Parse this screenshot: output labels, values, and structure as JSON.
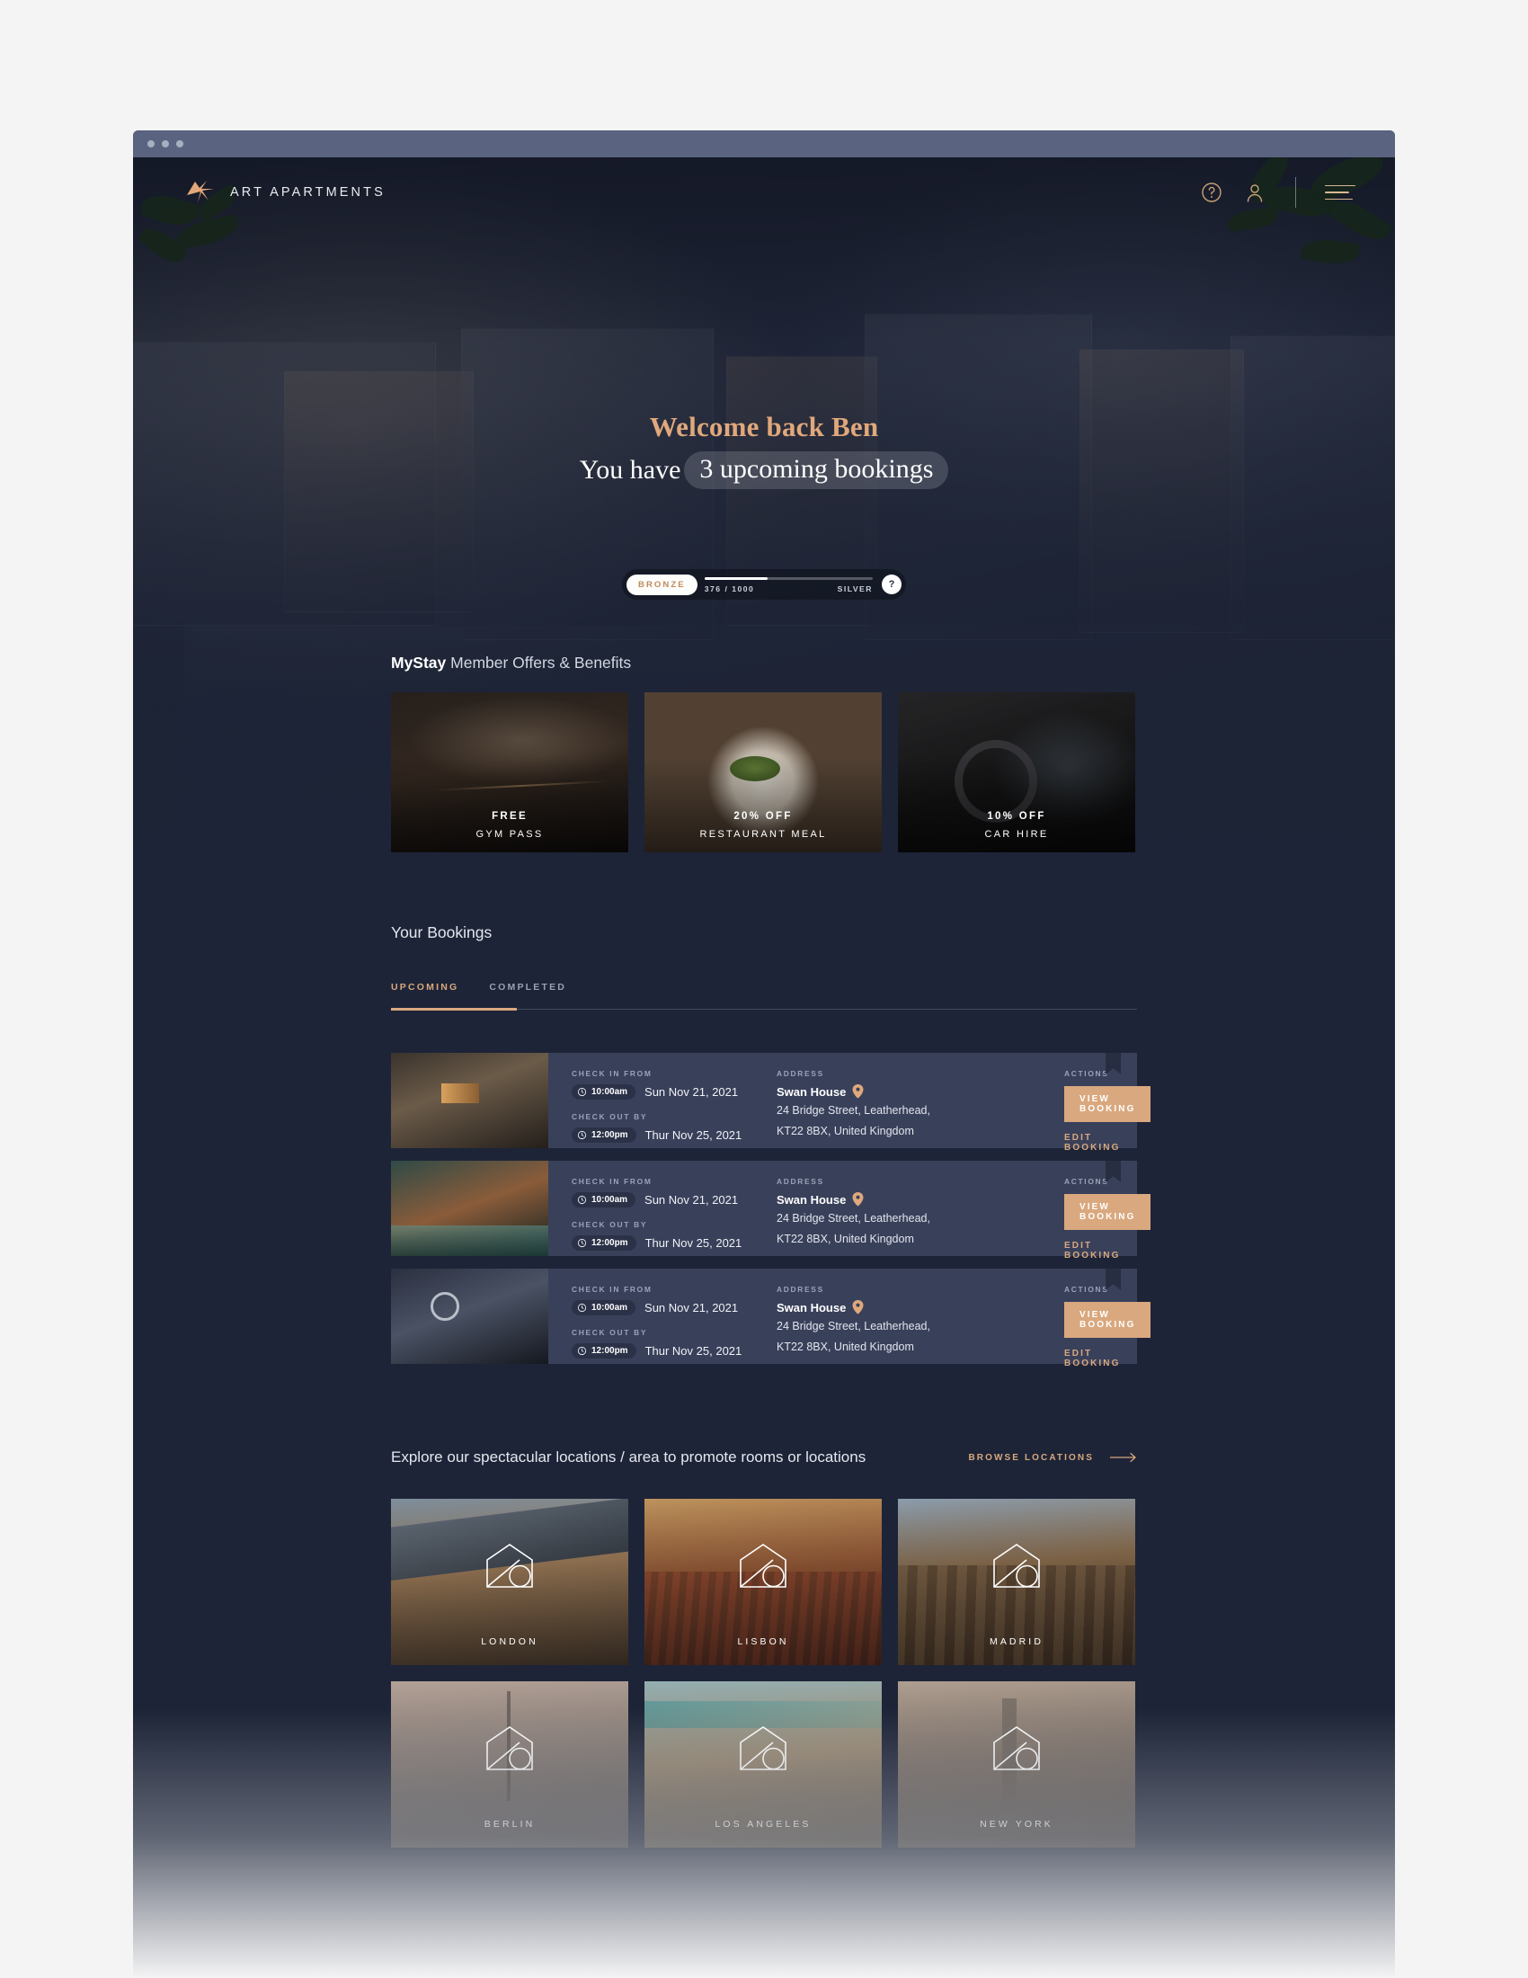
{
  "brand": {
    "name": "ART APARTMENTS",
    "logo_icon": "starburst-logo-icon",
    "accent": "#d9a87e"
  },
  "topbar": {
    "help_icon": "question-circle-icon",
    "account_icon": "user-account-icon",
    "menu_icon": "hamburger-menu-icon"
  },
  "hero": {
    "welcome_line": "Welcome back Ben",
    "you_have": "You have",
    "bookings_count_text": "3 upcoming bookings"
  },
  "tier": {
    "current": "BRONZE",
    "progress_text": "376 / 1000",
    "next": "SILVER",
    "help_label": "?",
    "progress_percent": 37.6
  },
  "offers": {
    "title_strong": "MyStay",
    "title_rest": " Member Offers & Benefits",
    "items": [
      {
        "big": "FREE",
        "sub": "GYM PASS",
        "image": "gym-interior-photo"
      },
      {
        "big": "20% OFF",
        "sub": "RESTAURANT MEAL",
        "image": "restaurant-plate-photo"
      },
      {
        "big": "10% OFF",
        "sub": "CAR HIRE",
        "image": "car-interior-photo"
      }
    ]
  },
  "bookings": {
    "heading": "Your Bookings",
    "tabs": [
      {
        "label": "UPCOMING",
        "active": true
      },
      {
        "label": "COMPLETED",
        "active": false
      }
    ],
    "labels": {
      "check_in": "CHECK IN FROM",
      "check_out": "CHECK OUT BY",
      "address": "ADDRESS",
      "actions": "ACTIONS",
      "view_button": "VIEW BOOKING",
      "edit_link": "EDIT BOOKING"
    },
    "rows": [
      {
        "thumb": "hotel-bedroom-photo",
        "check_in_time": "10:00am",
        "check_in_date": "Sun Nov 21, 2021",
        "check_out_time": "12:00pm",
        "check_out_date": "Thur Nov 25, 2021",
        "property": "Swan House",
        "address_line1": "24 Bridge Street, Leatherhead,",
        "address_line2": "KT22 8BX, United Kingdom"
      },
      {
        "thumb": "indoor-pool-photo",
        "check_in_time": "10:00am",
        "check_in_date": "Sun Nov 21, 2021",
        "check_out_time": "12:00pm",
        "check_out_date": "Thur Nov 25, 2021",
        "property": "Swan House",
        "address_line1": "24 Bridge Street, Leatherhead,",
        "address_line2": "KT22 8BX, United Kingdom"
      },
      {
        "thumb": "lounge-sofa-photo",
        "check_in_time": "10:00am",
        "check_in_date": "Sun Nov 21, 2021",
        "check_out_time": "12:00pm",
        "check_out_date": "Thur Nov 25, 2021",
        "property": "Swan House",
        "address_line1": "24 Bridge Street, Leatherhead,",
        "address_line2": "KT22 8BX, United Kingdom"
      }
    ]
  },
  "explore": {
    "heading": "Explore our spectacular locations / area to promote rooms or locations",
    "browse_label": "BROWSE LOCATIONS",
    "browse_icon": "arrow-right-icon",
    "cities": [
      {
        "name": "LONDON",
        "image": "london-bridge-photo"
      },
      {
        "name": "LISBON",
        "image": "lisbon-rooftops-photo"
      },
      {
        "name": "MADRID",
        "image": "madrid-skyline-photo"
      },
      {
        "name": "BERLIN",
        "image": "berlin-tower-photo"
      },
      {
        "name": "LOS ANGELES",
        "image": "los-angeles-photo"
      },
      {
        "name": "NEW YORK",
        "image": "new-york-skyline-photo"
      }
    ]
  }
}
